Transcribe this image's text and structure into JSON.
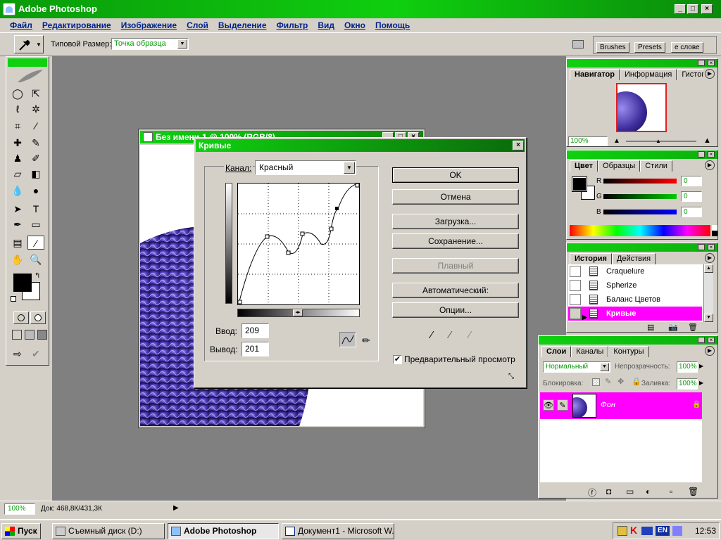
{
  "app": {
    "title": "Adobe Photoshop"
  },
  "menu": [
    "Файл",
    "Редактирование",
    "Изображение",
    "Слой",
    "Выделение",
    "Фильтр",
    "Вид",
    "Окно",
    "Помощь"
  ],
  "options": {
    "size_label": "Типовой Размер:",
    "size_value": "Точка образца",
    "palette_tabs": [
      "Brushes",
      "Presets",
      "е слове"
    ]
  },
  "document": {
    "title": "Без имени-1 @ 100% (RGB/8)"
  },
  "curves": {
    "title": "Кривые",
    "channel_label": "Канал:",
    "channel_value": "Красный",
    "input_label": "Ввод:",
    "input_value": "209",
    "output_label": "Вывод:",
    "output_value": "201",
    "buttons": {
      "ok": "OK",
      "cancel": "Отмена",
      "load": "Загрузка...",
      "save": "Сохранение...",
      "smooth": "Плавный",
      "auto": "Автоматический:",
      "options": "Опции..."
    },
    "preview_label": "Предварительный просмотр",
    "preview_checked": true
  },
  "navigator": {
    "tabs": [
      "Навигатор",
      "Информация",
      "Гистограмма"
    ],
    "zoom": "100%"
  },
  "color": {
    "tabs": [
      "Цвет",
      "Образцы",
      "Стили"
    ],
    "channels": [
      {
        "label": "R",
        "value": "0",
        "color": "#ff0000"
      },
      {
        "label": "G",
        "value": "0",
        "color": "#00b000"
      },
      {
        "label": "B",
        "value": "0",
        "color": "#0000ff"
      }
    ]
  },
  "history": {
    "tabs": [
      "История",
      "Действия"
    ],
    "items": [
      "Craquelure",
      "Spherize",
      "Баланс Цветов",
      "Кривые"
    ]
  },
  "layers": {
    "tabs": [
      "Слои",
      "Каналы",
      "Контуры"
    ],
    "blend_mode": "Нормальный",
    "opacity_label": "Непрозрачность:",
    "opacity_value": "100%",
    "lock_label": "Блокировка:",
    "fill_label": "Заливка:",
    "fill_value": "100%",
    "layer_name": "Фон"
  },
  "status": {
    "zoom": "100%",
    "doc_info": "Док: 468,8К/431,3К"
  },
  "taskbar": {
    "start": "Пуск",
    "tasks": [
      "Съемный диск (D:)",
      "Adobe Photoshop",
      "Документ1 - Microsoft W..."
    ],
    "tray_lang": "EN",
    "clock": "12:53"
  },
  "colors": {
    "accent_green": "#10d010",
    "highlight_magenta": "#ff00ff",
    "link_blue": "#00238a"
  }
}
